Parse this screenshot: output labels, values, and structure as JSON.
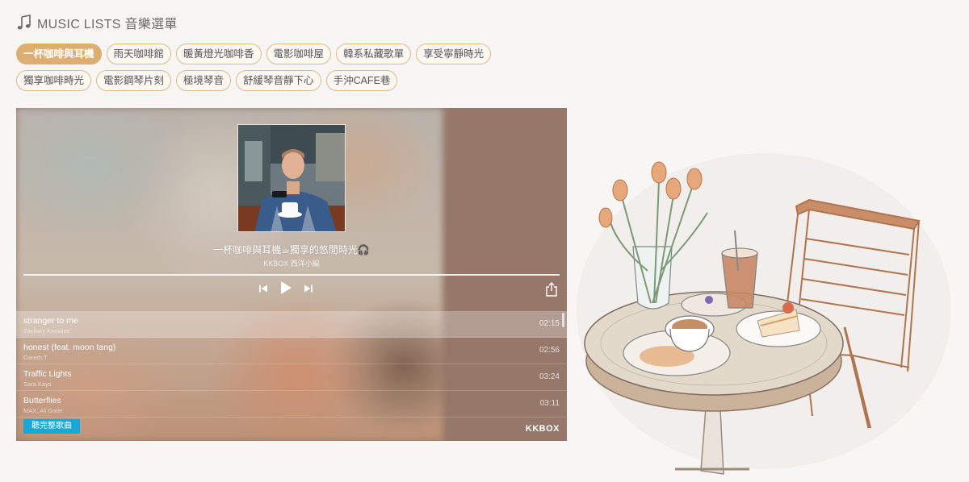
{
  "header": {
    "title": "MUSIC LISTS 音樂選單",
    "icon": "music-note-icon"
  },
  "tags": [
    {
      "label": "一杯咖啡與耳機",
      "active": true
    },
    {
      "label": "雨天咖啡館"
    },
    {
      "label": "暖黃燈光咖啡香"
    },
    {
      "label": "電影咖啡屋"
    },
    {
      "label": "韓系私藏歌單"
    },
    {
      "label": "享受寧靜時光"
    },
    {
      "label": "獨享咖啡時光"
    },
    {
      "label": "電影鋼琴片刻"
    },
    {
      "label": "極境琴音"
    },
    {
      "label": "舒緩琴音靜下心"
    },
    {
      "label": "手沖CAFE巷"
    }
  ],
  "player": {
    "playlist_title": "一杯咖啡與耳機☕獨享的悠閒時光🎧",
    "curator": "KKBOX 西洋小編",
    "listen_full_label": "聽完整歌曲",
    "brand": "KKBOX",
    "tracks": [
      {
        "name": "stranger to me",
        "artist": "Zachary Knowles",
        "duration": "02:15"
      },
      {
        "name": "honest (feat. moon tang)",
        "artist": "Gareth.T",
        "duration": "02:56"
      },
      {
        "name": "Traffic Lights",
        "artist": "Sara Kays",
        "duration": "03:24"
      },
      {
        "name": "Butterflies",
        "artist": "MAX, Ali Gatie",
        "duration": "03:11"
      }
    ]
  },
  "colors": {
    "accent": "#dcae72",
    "tag_border": "#e0b98a",
    "player_bg": "#8e6d5e",
    "button": "#18a8d8"
  }
}
